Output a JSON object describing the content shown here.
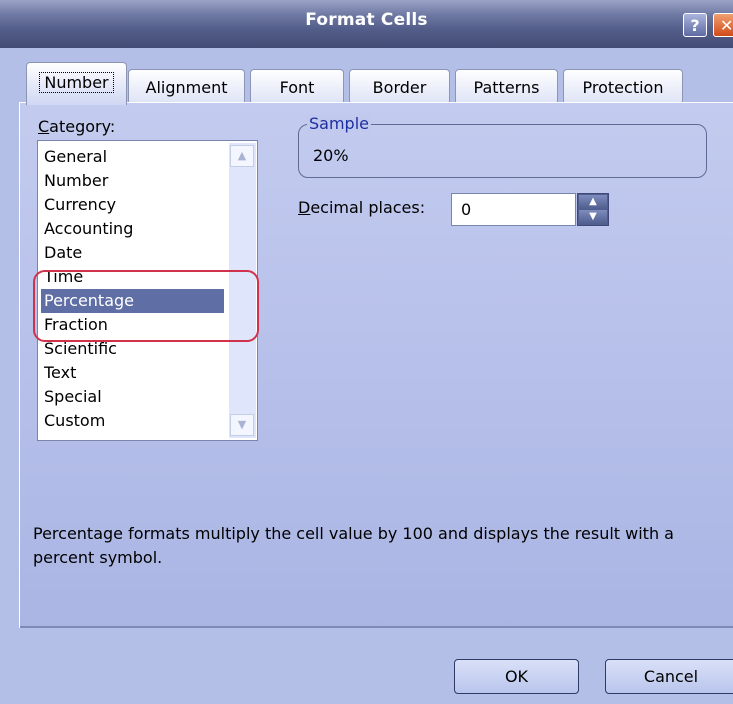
{
  "window": {
    "title": "Format Cells",
    "help_glyph": "?",
    "close_glyph": "✕"
  },
  "tabs": [
    {
      "label": "Number",
      "active": true
    },
    {
      "label": "Alignment",
      "active": false
    },
    {
      "label": "Font",
      "active": false
    },
    {
      "label": "Border",
      "active": false
    },
    {
      "label": "Patterns",
      "active": false
    },
    {
      "label": "Protection",
      "active": false
    }
  ],
  "category": {
    "label_first": "C",
    "label_rest": "ategory:",
    "items": [
      "General",
      "Number",
      "Currency",
      "Accounting",
      "Date",
      "Time",
      "Percentage",
      "Fraction",
      "Scientific",
      "Text",
      "Special",
      "Custom"
    ],
    "selected": "Percentage"
  },
  "sample": {
    "legend": "Sample",
    "value": "20%"
  },
  "decimal": {
    "label_first": "D",
    "label_rest": "ecimal places:",
    "value": "0"
  },
  "description": "Percentage formats multiply the cell value by 100 and displays the result with a percent symbol.",
  "buttons": {
    "ok": "OK",
    "cancel": "Cancel"
  },
  "icons": {
    "scroll_up": "scroll-up-arrow",
    "scroll_down": "scroll-down-arrow",
    "spin_up": "spin-up-arrow",
    "spin_down": "spin-down-arrow"
  },
  "colors": {
    "title_bar": "#545e8a",
    "selection": "#5f6fa6",
    "highlight_ring": "#d0314b",
    "dialog_bg": "#b4bfe8"
  }
}
